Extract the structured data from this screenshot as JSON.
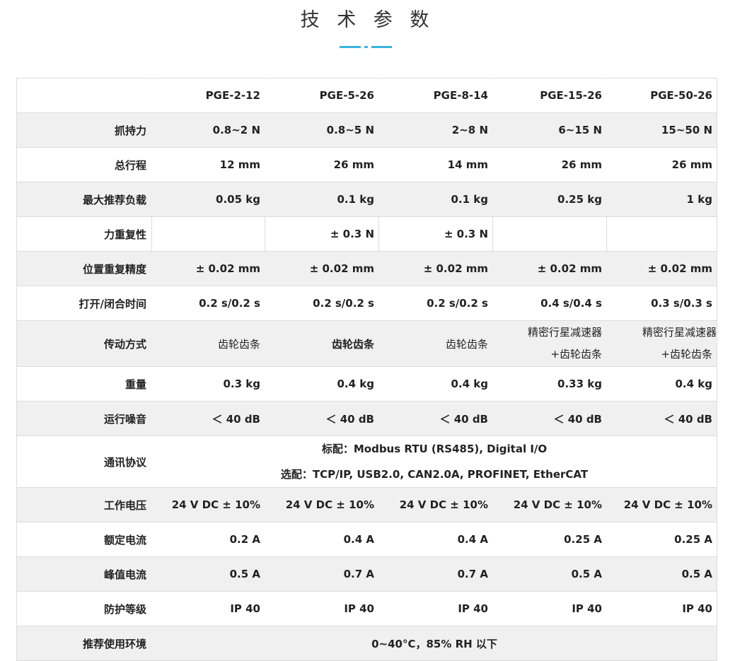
{
  "title": "技 术 参 数",
  "accent_color": "#3bb3e0",
  "models": [
    "PGE-2-12",
    "PGE-5-26",
    "PGE-8-14",
    "PGE-15-26",
    "PGE-50-26"
  ],
  "rows": {
    "grip_force": {
      "label": "抓持力",
      "values": [
        "0.8~2 N",
        "0.8~5 N",
        "2~8 N",
        "6~15 N",
        "15~50 N"
      ]
    },
    "stroke": {
      "label": "总行程",
      "values": [
        "12 mm",
        "26 mm",
        "14 mm",
        "26 mm",
        "26 mm"
      ]
    },
    "payload": {
      "label": "最大推荐负载",
      "values": [
        "0.05 kg",
        "0.1 kg",
        "0.1 kg",
        "0.25 kg",
        "1 kg"
      ]
    },
    "force_repeat": {
      "label": "力重复性",
      "values": [
        "",
        "± 0.3 N",
        "± 0.3 N",
        "",
        ""
      ]
    },
    "pos_repeat": {
      "label": "位置重复精度",
      "values": [
        "± 0.02 mm",
        "± 0.02 mm",
        "± 0.02 mm",
        "± 0.02 mm",
        "± 0.02 mm"
      ]
    },
    "open_close": {
      "label": "打开/闭合时间",
      "values": [
        "0.2 s/0.2 s",
        "0.2 s/0.2 s",
        "0.2 s/0.2 s",
        "0.4 s/0.4 s",
        "0.3 s/0.3 s"
      ]
    },
    "drive": {
      "label": "传动方式",
      "values": [
        "齿轮齿条",
        "齿轮齿条",
        "齿轮齿条"
      ],
      "v4_line1": "精密行星减速器",
      "v4_line2": "+齿轮齿条",
      "v5_line1": "精密行星减速器",
      "v5_line2": "+齿轮齿条"
    },
    "weight": {
      "label": "重量",
      "values": [
        "0.3 kg",
        "0.4 kg",
        "0.4 kg",
        "0.33 kg",
        "0.4 kg"
      ]
    },
    "noise": {
      "label": "运行噪音",
      "values": [
        "＜ 40 dB",
        "＜ 40 dB",
        "＜ 40 dB",
        "＜ 40 dB",
        "＜ 40 dB"
      ]
    },
    "protocol": {
      "label": "通讯协议",
      "standard": "标配：Modbus RTU (RS485), Digital I/O",
      "optional": "选配：TCP/IP, USB2.0, CAN2.0A, PROFINET, EtherCAT"
    },
    "voltage": {
      "label": "工作电压",
      "values": [
        "24 V DC ± 10%",
        "24 V DC ± 10%",
        "24 V DC ± 10%",
        "24 V DC ± 10%",
        "24 V DC ± 10%"
      ]
    },
    "rated_current": {
      "label": "额定电流",
      "values": [
        "0.2 A",
        "0.4 A",
        "0.4 A",
        "0.25 A",
        "0.25 A"
      ]
    },
    "peak_current": {
      "label": "峰值电流",
      "values": [
        "0.5 A",
        "0.7 A",
        "0.7 A",
        "0.5 A",
        "0.5 A"
      ]
    },
    "protection": {
      "label": "防护等级",
      "values": [
        "IP 40",
        "IP 40",
        "IP 40",
        "IP 40",
        "IP 40"
      ]
    },
    "environment": {
      "label": "推荐使用环境",
      "value": "0~40°C，85% RH 以下"
    }
  }
}
